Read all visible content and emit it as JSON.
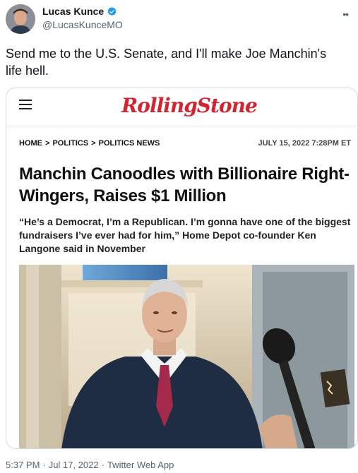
{
  "tweet": {
    "author_name": "Lucas Kunce",
    "author_handle": "@LucasKunceMO",
    "text": "Send me to the U.S. Senate, and I'll make Joe Manchin's life hell.",
    "more_icon": "ellipsis-icon",
    "time": "5:37 PM",
    "date": "Jul 17, 2022",
    "source": "Twitter Web App",
    "separator": "·"
  },
  "card": {
    "logo": "RollingStone",
    "breadcrumb": [
      "HOME",
      "POLITICS",
      "POLITICS NEWS"
    ],
    "breadcrumb_sep": ">",
    "published": "JULY 15, 2022 7:28PM ET",
    "headline": "Manchin Canoodles with Billionaire Right-Wingers, Raises $1 Million",
    "dek": "“He’s a Democrat, I’m a Republican. I’m gonna have one of the biggest fundraisers I’ve ever had for him,” Home Depot co-founder Ken Langone said in November"
  },
  "colors": {
    "brand_red": "#d32531",
    "verified_blue": "#1d9bf0",
    "muted_text": "#536471"
  }
}
